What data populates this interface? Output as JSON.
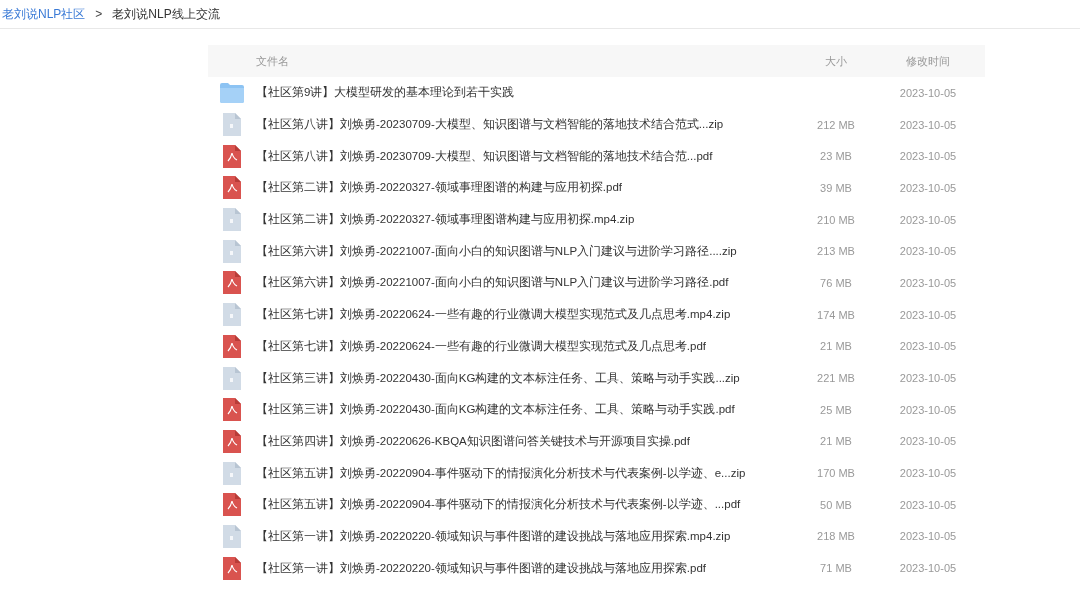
{
  "breadcrumb": {
    "parent": "老刘说NLP社区",
    "separator": ">",
    "current": "老刘说NLP线上交流"
  },
  "table": {
    "columns": [
      "文件名",
      "大小",
      "修改时间"
    ],
    "rows": [
      {
        "kind": "folder",
        "name": "【社区第9讲】大模型研发的基本理论到若干实践",
        "date": "2023-10-05"
      },
      {
        "kind": "zip",
        "name": "【社区第八讲】刘焕勇-20230709-大模型、知识图谱与文档智能的落地技术结合范式...zip",
        "size": "212 MB",
        "date": "2023-10-05"
      },
      {
        "kind": "pdf",
        "name": "【社区第八讲】刘焕勇-20230709-大模型、知识图谱与文档智能的落地技术结合范...pdf",
        "size": "23 MB",
        "date": "2023-10-05"
      },
      {
        "kind": "pdf",
        "name": "【社区第二讲】刘焕勇-20220327-领域事理图谱的构建与应用初探.pdf",
        "size": "39 MB",
        "date": "2023-10-05"
      },
      {
        "kind": "zip",
        "name": "【社区第二讲】刘焕勇-20220327-领域事理图谱构建与应用初探.mp4.zip",
        "size": "210 MB",
        "date": "2023-10-05"
      },
      {
        "kind": "zip",
        "name": "【社区第六讲】刘焕勇-20221007-面向小白的知识图谱与NLP入门建议与进阶学习路径....zip",
        "size": "213 MB",
        "date": "2023-10-05"
      },
      {
        "kind": "pdf",
        "name": "【社区第六讲】刘焕勇-20221007-面向小白的知识图谱与NLP入门建议与进阶学习路径.pdf",
        "size": "76 MB",
        "date": "2023-10-05"
      },
      {
        "kind": "zip",
        "name": "【社区第七讲】刘焕勇-20220624-一些有趣的行业微调大模型实现范式及几点思考.mp4.zip",
        "size": "174 MB",
        "date": "2023-10-05"
      },
      {
        "kind": "pdf",
        "name": "【社区第七讲】刘焕勇-20220624-一些有趣的行业微调大模型实现范式及几点思考.pdf",
        "size": "21 MB",
        "date": "2023-10-05"
      },
      {
        "kind": "zip",
        "name": "【社区第三讲】刘焕勇-20220430-面向KG构建的文本标注任务、工具、策略与动手实践...zip",
        "size": "221 MB",
        "date": "2023-10-05"
      },
      {
        "kind": "pdf",
        "name": "【社区第三讲】刘焕勇-20220430-面向KG构建的文本标注任务、工具、策略与动手实践.pdf",
        "size": "25 MB",
        "date": "2023-10-05"
      },
      {
        "kind": "pdf",
        "name": "【社区第四讲】刘焕勇-20220626-KBQA知识图谱问答关键技术与开源项目实操.pdf",
        "size": "21 MB",
        "date": "2023-10-05"
      },
      {
        "kind": "zip",
        "name": "【社区第五讲】刘焕勇-20220904-事件驱动下的情报演化分析技术与代表案例-以学迹、e...zip",
        "size": "170 MB",
        "date": "2023-10-05"
      },
      {
        "kind": "pdf",
        "name": "【社区第五讲】刘焕勇-20220904-事件驱动下的情报演化分析技术与代表案例-以学迹、...pdf",
        "size": "50 MB",
        "date": "2023-10-05"
      },
      {
        "kind": "zip",
        "name": "【社区第一讲】刘焕勇-20220220-领域知识与事件图谱的建设挑战与落地应用探索.mp4.zip",
        "size": "218 MB",
        "date": "2023-10-05"
      },
      {
        "kind": "pdf",
        "name": "【社区第一讲】刘焕勇-20220220-领域知识与事件图谱的建设挑战与落地应用探索.pdf",
        "size": "71 MB",
        "date": "2023-10-05"
      }
    ]
  }
}
